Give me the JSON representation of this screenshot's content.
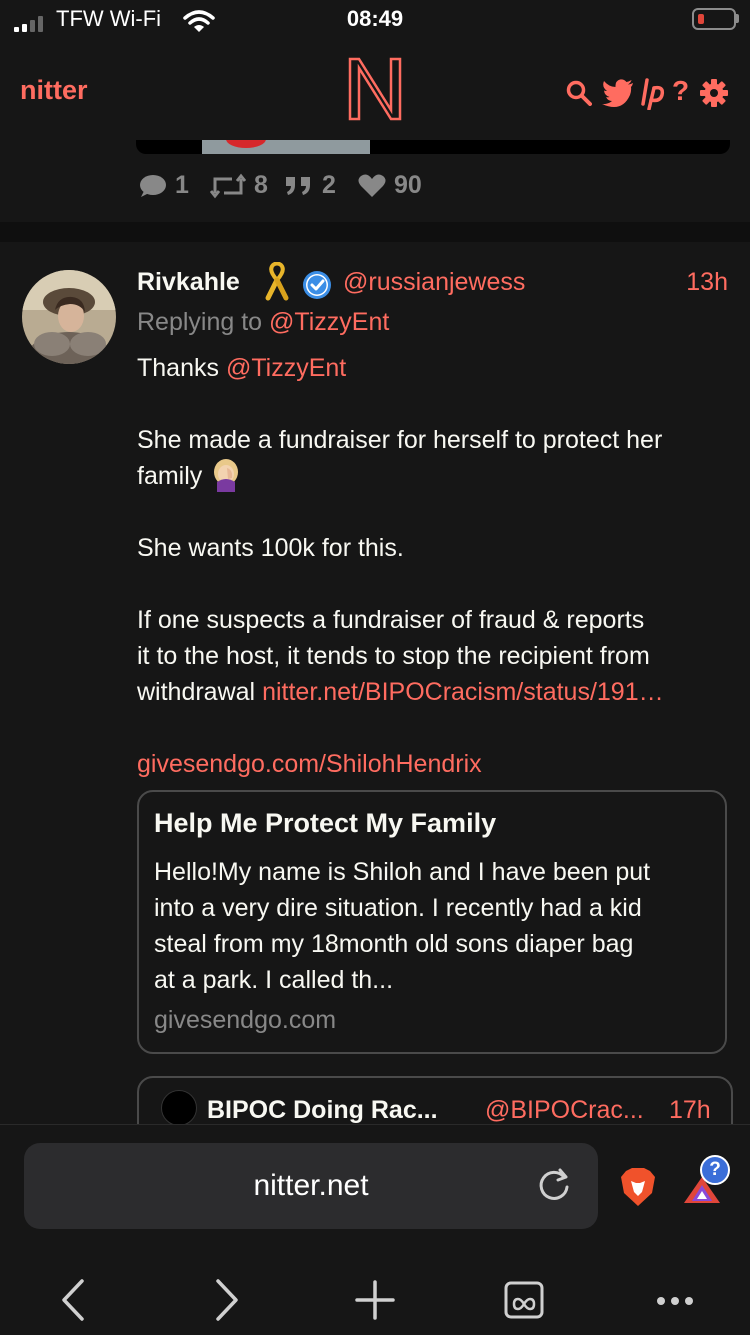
{
  "status_bar": {
    "carrier": "TFW Wi-Fi",
    "time": "08:49"
  },
  "nav": {
    "brand": "nitter",
    "icons": [
      "search-icon",
      "twitter-bird-icon",
      "lp-icon",
      "help-icon",
      "settings-icon"
    ],
    "help_label": "?"
  },
  "previous_tweet": {
    "replies": "1",
    "retweets": "8",
    "quotes": "2",
    "likes": "90"
  },
  "tweet": {
    "fullname": "Rivkahle",
    "username": "@russianjewess",
    "time": "13h",
    "replying_prefix": "Replying to",
    "replying_to": "@TizzyEnt",
    "thanks_prefix": "Thanks",
    "thanks_mention": "@TizzyEnt",
    "line2a": "She made a fundraiser for herself to protect her",
    "line2b": "family",
    "line3": "She wants 100k for this.",
    "line4a": "If one suspects a fundraiser of  fraud & reports",
    "line4b": "it to the host, it tends to stop the recipient from",
    "line4c_prefix": "withdrawal",
    "line4c_link": "nitter.net/BIPOCracism/status/191…",
    "link2": "givesendgo.com/ShilohHendrix",
    "card": {
      "title": "Help Me Protect My Family",
      "desc1": "Hello!My name is Shiloh and I have been put",
      "desc2": "into a very dire situation. I recently had a kid",
      "desc3": "steal from my 18month old sons diaper bag",
      "desc4": "at a park. I called th...",
      "destination": "givesendgo.com"
    },
    "quote": {
      "fullname": "BIPOC Doing Rac...",
      "username": "@BIPOCrac...",
      "time": "17h"
    }
  },
  "browser": {
    "url": "nitter.net",
    "badge": "?"
  },
  "colors": {
    "accent": "#ff6c60",
    "background": "#0f0f0f",
    "card_background": "#161616",
    "muted": "#888888"
  }
}
